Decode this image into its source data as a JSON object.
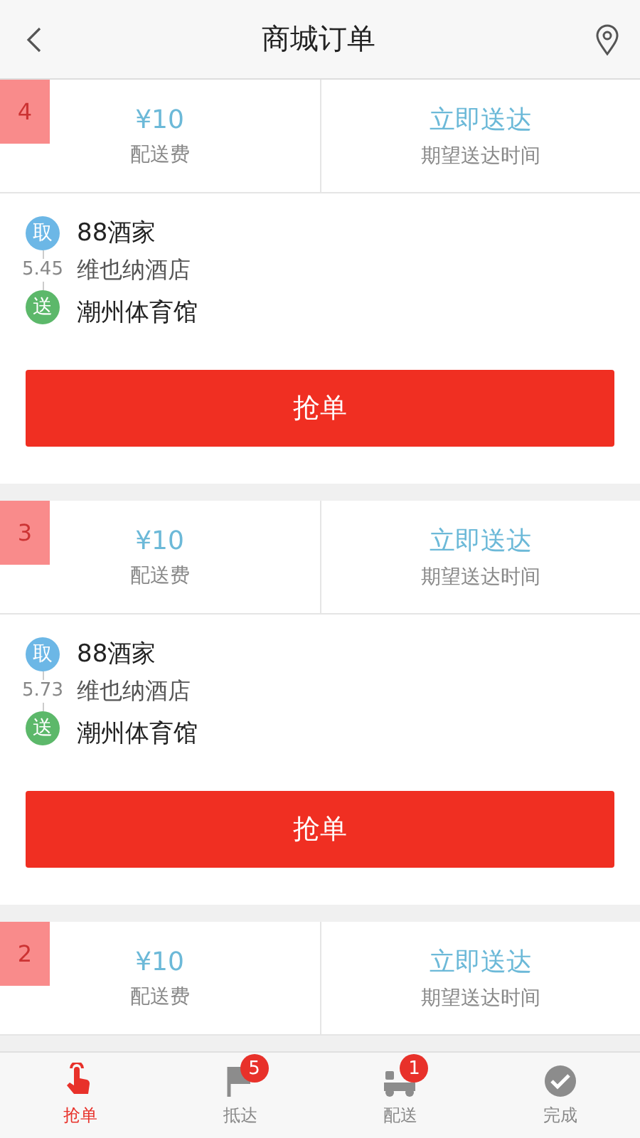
{
  "header": {
    "title": "商城订单"
  },
  "orders": [
    {
      "number": "4",
      "fee": "¥10",
      "fee_label": "配送费",
      "time": "立即送达",
      "time_label": "期望送达时间",
      "pickup_badge": "取",
      "pickup_name": "88酒家",
      "pickup_address": "维也纳酒店",
      "distance": "5.45",
      "dropoff_badge": "送",
      "dropoff_name": "潮州体育馆",
      "button": "抢单"
    },
    {
      "number": "3",
      "fee": "¥10",
      "fee_label": "配送费",
      "time": "立即送达",
      "time_label": "期望送达时间",
      "pickup_badge": "取",
      "pickup_name": "88酒家",
      "pickup_address": "维也纳酒店",
      "distance": "5.73",
      "dropoff_badge": "送",
      "dropoff_name": "潮州体育馆",
      "button": "抢单"
    },
    {
      "number": "2",
      "fee": "¥10",
      "fee_label": "配送费",
      "time": "立即送达",
      "time_label": "期望送达时间"
    }
  ],
  "tabs": [
    {
      "kind": "grab",
      "label": "抢单",
      "selected": true
    },
    {
      "kind": "arrive",
      "label": "抵达",
      "selected": false,
      "badge": "5"
    },
    {
      "kind": "deliver",
      "label": "配送",
      "selected": false,
      "badge": "1"
    },
    {
      "kind": "done",
      "label": "完成",
      "selected": false
    }
  ]
}
